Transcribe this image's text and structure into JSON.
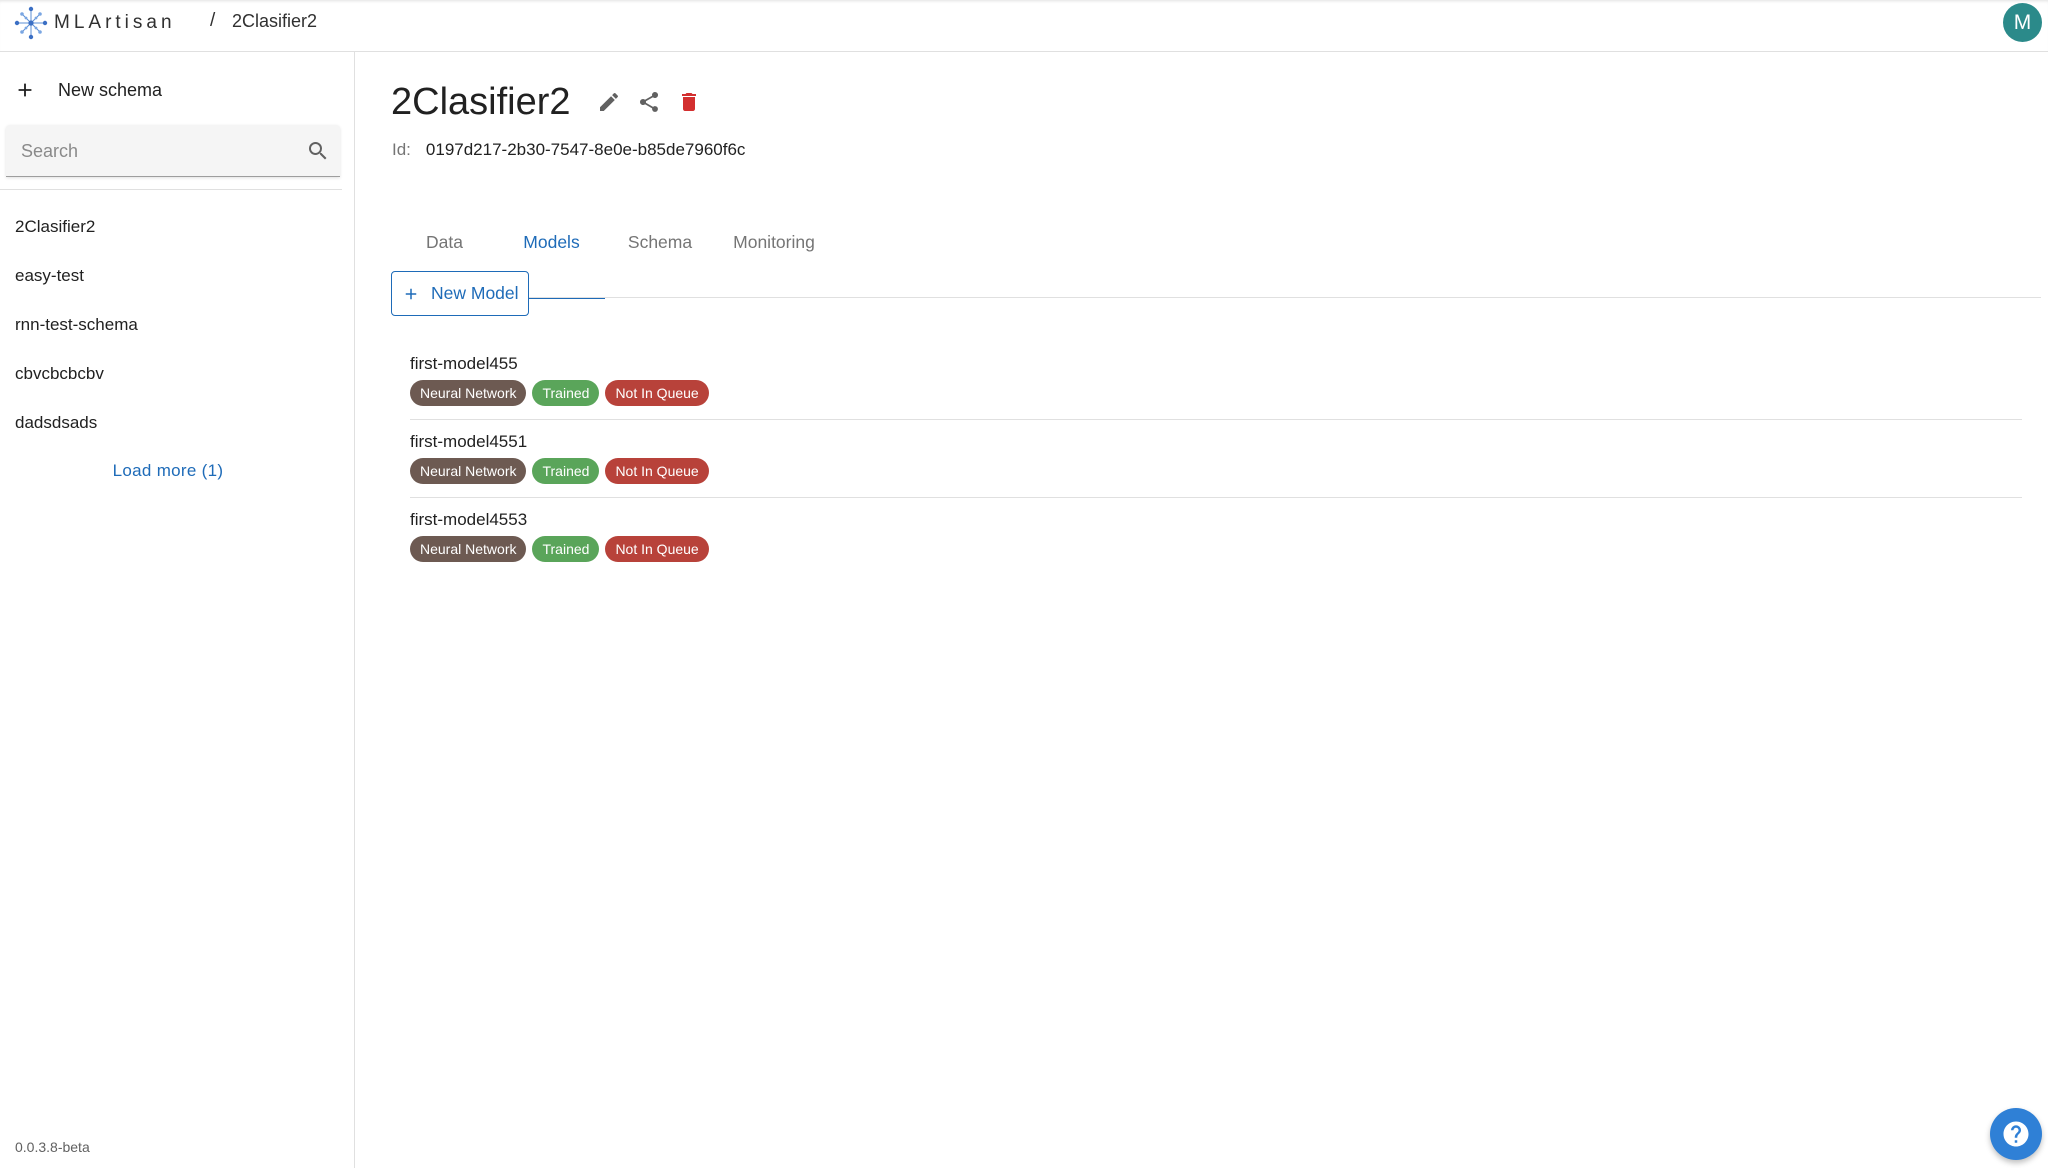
{
  "header": {
    "logo_text": "MLArtisan",
    "breadcrumb_separator": "/",
    "breadcrumb_current": "2Clasifier2",
    "avatar_initial": "M"
  },
  "sidebar": {
    "new_schema_label": "New schema",
    "search_placeholder": "Search",
    "search_value": "",
    "items": [
      {
        "label": "2Clasifier2"
      },
      {
        "label": "easy-test"
      },
      {
        "label": "rnn-test-schema"
      },
      {
        "label": "cbvcbcbcbv"
      },
      {
        "label": "dadsdsads"
      }
    ],
    "load_more_label": "Load more (1)",
    "version": "0.0.3.8-beta"
  },
  "main": {
    "title": "2Clasifier2",
    "id_label": "Id:",
    "id_value": "0197d217-2b30-7547-8e0e-b85de7960f6c",
    "tabs": [
      {
        "label": "Data"
      },
      {
        "label": "Models",
        "active": true
      },
      {
        "label": "Schema"
      },
      {
        "label": "Monitoring"
      }
    ],
    "new_model_label": "New Model",
    "models": [
      {
        "name": "first-model455",
        "chips": [
          {
            "label": "Neural Network",
            "color": "#6d5a52"
          },
          {
            "label": "Trained",
            "color": "#5aa55a"
          },
          {
            "label": "Not In Queue",
            "color": "#b8423a"
          }
        ]
      },
      {
        "name": "first-model4551",
        "chips": [
          {
            "label": "Neural Network",
            "color": "#6d5a52"
          },
          {
            "label": "Trained",
            "color": "#5aa55a"
          },
          {
            "label": "Not In Queue",
            "color": "#b8423a"
          }
        ]
      },
      {
        "name": "first-model4553",
        "chips": [
          {
            "label": "Neural Network",
            "color": "#6d5a52"
          },
          {
            "label": "Trained",
            "color": "#5aa55a"
          },
          {
            "label": "Not In Queue",
            "color": "#b8423a"
          }
        ]
      }
    ]
  },
  "colors": {
    "accent": "#1e6bb8",
    "avatar_bg": "#2b8a8a",
    "delete_red": "#d32f2f",
    "fab_bg": "#2f80d6"
  },
  "icons": {
    "logo": "network-nodes-icon",
    "add": "plus-icon",
    "search": "search-icon",
    "edit": "pencil-icon",
    "share": "share-icon",
    "delete": "trash-icon",
    "help": "question-mark-icon"
  }
}
